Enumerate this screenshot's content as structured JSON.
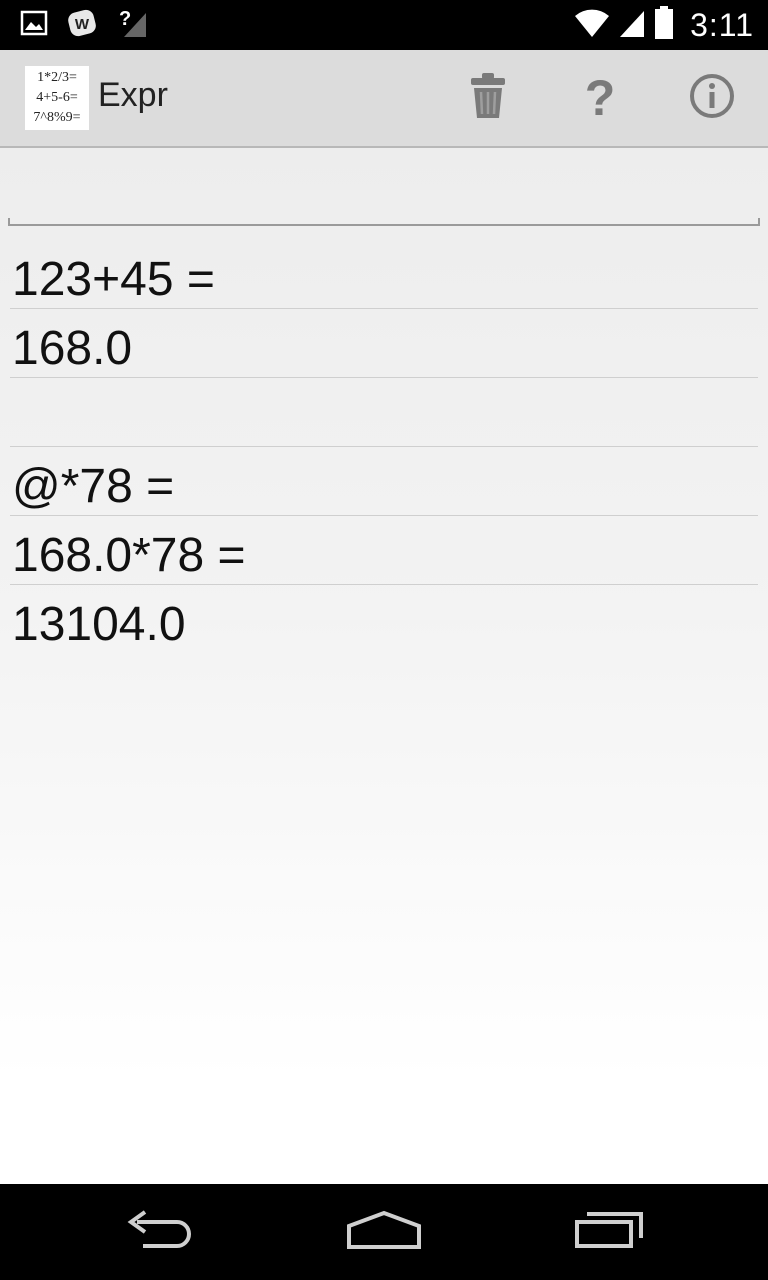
{
  "status_bar": {
    "time": "3:11",
    "icons": [
      "image-notification-icon",
      "w-app-notification-icon",
      "no-signal-icon",
      "wifi-icon",
      "cell-signal-icon",
      "battery-icon"
    ]
  },
  "action_bar": {
    "app_icon_lines": [
      "1*2/3=",
      "4+5-6=",
      "7^8%9="
    ],
    "title": "Expr",
    "actions": [
      "trash-icon",
      "help-icon",
      "info-icon"
    ],
    "help_glyph": "?"
  },
  "input": {
    "value": "",
    "placeholder": ""
  },
  "history": [
    "123+45 =",
    "168.0",
    "",
    "@*78 =",
    "168.0*78 =",
    "13104.0"
  ],
  "colors": {
    "status_bar": "#000000",
    "action_bar": "#dcdcdc",
    "icon_gray": "#7a7a7a",
    "nav_bar": "#000000"
  }
}
